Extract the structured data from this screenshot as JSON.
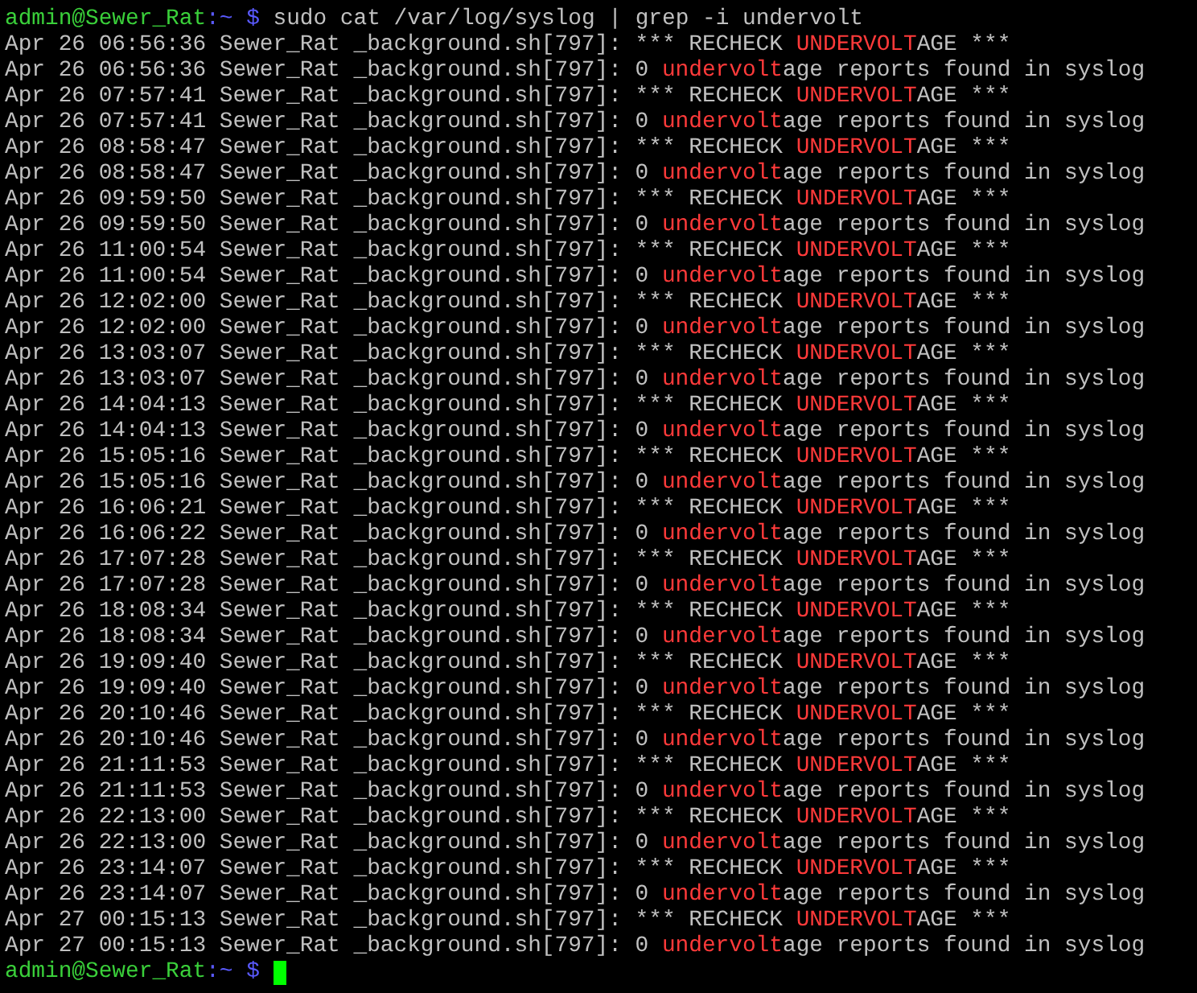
{
  "prompt": {
    "user_host": "admin@Sewer_Rat",
    "path": ":~",
    "symbol": "$",
    "command": "sudo cat /var/log/syslog | grep -i undervolt"
  },
  "lines": [
    {
      "segments": [
        {
          "text": "Apr 26 06:56:36 Sewer_Rat _background.sh[797]: *** RECHECK ",
          "kind": "plain"
        },
        {
          "text": "UNDERVOLT",
          "kind": "match"
        },
        {
          "text": "AGE ***",
          "kind": "plain"
        }
      ]
    },
    {
      "segments": [
        {
          "text": "Apr 26 06:56:36 Sewer_Rat _background.sh[797]: 0 ",
          "kind": "plain"
        },
        {
          "text": "undervolt",
          "kind": "match"
        },
        {
          "text": "age reports found in syslog",
          "kind": "plain"
        }
      ]
    },
    {
      "segments": [
        {
          "text": "Apr 26 07:57:41 Sewer_Rat _background.sh[797]: *** RECHECK ",
          "kind": "plain"
        },
        {
          "text": "UNDERVOLT",
          "kind": "match"
        },
        {
          "text": "AGE ***",
          "kind": "plain"
        }
      ]
    },
    {
      "segments": [
        {
          "text": "Apr 26 07:57:41 Sewer_Rat _background.sh[797]: 0 ",
          "kind": "plain"
        },
        {
          "text": "undervolt",
          "kind": "match"
        },
        {
          "text": "age reports found in syslog",
          "kind": "plain"
        }
      ]
    },
    {
      "segments": [
        {
          "text": "Apr 26 08:58:47 Sewer_Rat _background.sh[797]: *** RECHECK ",
          "kind": "plain"
        },
        {
          "text": "UNDERVOLT",
          "kind": "match"
        },
        {
          "text": "AGE ***",
          "kind": "plain"
        }
      ]
    },
    {
      "segments": [
        {
          "text": "Apr 26 08:58:47 Sewer_Rat _background.sh[797]: 0 ",
          "kind": "plain"
        },
        {
          "text": "undervolt",
          "kind": "match"
        },
        {
          "text": "age reports found in syslog",
          "kind": "plain"
        }
      ]
    },
    {
      "segments": [
        {
          "text": "Apr 26 09:59:50 Sewer_Rat _background.sh[797]: *** RECHECK ",
          "kind": "plain"
        },
        {
          "text": "UNDERVOLT",
          "kind": "match"
        },
        {
          "text": "AGE ***",
          "kind": "plain"
        }
      ]
    },
    {
      "segments": [
        {
          "text": "Apr 26 09:59:50 Sewer_Rat _background.sh[797]: 0 ",
          "kind": "plain"
        },
        {
          "text": "undervolt",
          "kind": "match"
        },
        {
          "text": "age reports found in syslog",
          "kind": "plain"
        }
      ]
    },
    {
      "segments": [
        {
          "text": "Apr 26 11:00:54 Sewer_Rat _background.sh[797]: *** RECHECK ",
          "kind": "plain"
        },
        {
          "text": "UNDERVOLT",
          "kind": "match"
        },
        {
          "text": "AGE ***",
          "kind": "plain"
        }
      ]
    },
    {
      "segments": [
        {
          "text": "Apr 26 11:00:54 Sewer_Rat _background.sh[797]: 0 ",
          "kind": "plain"
        },
        {
          "text": "undervolt",
          "kind": "match"
        },
        {
          "text": "age reports found in syslog",
          "kind": "plain"
        }
      ]
    },
    {
      "segments": [
        {
          "text": "Apr 26 12:02:00 Sewer_Rat _background.sh[797]: *** RECHECK ",
          "kind": "plain"
        },
        {
          "text": "UNDERVOLT",
          "kind": "match"
        },
        {
          "text": "AGE ***",
          "kind": "plain"
        }
      ]
    },
    {
      "segments": [
        {
          "text": "Apr 26 12:02:00 Sewer_Rat _background.sh[797]: 0 ",
          "kind": "plain"
        },
        {
          "text": "undervolt",
          "kind": "match"
        },
        {
          "text": "age reports found in syslog",
          "kind": "plain"
        }
      ]
    },
    {
      "segments": [
        {
          "text": "Apr 26 13:03:07 Sewer_Rat _background.sh[797]: *** RECHECK ",
          "kind": "plain"
        },
        {
          "text": "UNDERVOLT",
          "kind": "match"
        },
        {
          "text": "AGE ***",
          "kind": "plain"
        }
      ]
    },
    {
      "segments": [
        {
          "text": "Apr 26 13:03:07 Sewer_Rat _background.sh[797]: 0 ",
          "kind": "plain"
        },
        {
          "text": "undervolt",
          "kind": "match"
        },
        {
          "text": "age reports found in syslog",
          "kind": "plain"
        }
      ]
    },
    {
      "segments": [
        {
          "text": "Apr 26 14:04:13 Sewer_Rat _background.sh[797]: *** RECHECK ",
          "kind": "plain"
        },
        {
          "text": "UNDERVOLT",
          "kind": "match"
        },
        {
          "text": "AGE ***",
          "kind": "plain"
        }
      ]
    },
    {
      "segments": [
        {
          "text": "Apr 26 14:04:13 Sewer_Rat _background.sh[797]: 0 ",
          "kind": "plain"
        },
        {
          "text": "undervolt",
          "kind": "match"
        },
        {
          "text": "age reports found in syslog",
          "kind": "plain"
        }
      ]
    },
    {
      "segments": [
        {
          "text": "Apr 26 15:05:16 Sewer_Rat _background.sh[797]: *** RECHECK ",
          "kind": "plain"
        },
        {
          "text": "UNDERVOLT",
          "kind": "match"
        },
        {
          "text": "AGE ***",
          "kind": "plain"
        }
      ]
    },
    {
      "segments": [
        {
          "text": "Apr 26 15:05:16 Sewer_Rat _background.sh[797]: 0 ",
          "kind": "plain"
        },
        {
          "text": "undervolt",
          "kind": "match"
        },
        {
          "text": "age reports found in syslog",
          "kind": "plain"
        }
      ]
    },
    {
      "segments": [
        {
          "text": "Apr 26 16:06:21 Sewer_Rat _background.sh[797]: *** RECHECK ",
          "kind": "plain"
        },
        {
          "text": "UNDERVOLT",
          "kind": "match"
        },
        {
          "text": "AGE ***",
          "kind": "plain"
        }
      ]
    },
    {
      "segments": [
        {
          "text": "Apr 26 16:06:22 Sewer_Rat _background.sh[797]: 0 ",
          "kind": "plain"
        },
        {
          "text": "undervolt",
          "kind": "match"
        },
        {
          "text": "age reports found in syslog",
          "kind": "plain"
        }
      ]
    },
    {
      "segments": [
        {
          "text": "Apr 26 17:07:28 Sewer_Rat _background.sh[797]: *** RECHECK ",
          "kind": "plain"
        },
        {
          "text": "UNDERVOLT",
          "kind": "match"
        },
        {
          "text": "AGE ***",
          "kind": "plain"
        }
      ]
    },
    {
      "segments": [
        {
          "text": "Apr 26 17:07:28 Sewer_Rat _background.sh[797]: 0 ",
          "kind": "plain"
        },
        {
          "text": "undervolt",
          "kind": "match"
        },
        {
          "text": "age reports found in syslog",
          "kind": "plain"
        }
      ]
    },
    {
      "segments": [
        {
          "text": "Apr 26 18:08:34 Sewer_Rat _background.sh[797]: *** RECHECK ",
          "kind": "plain"
        },
        {
          "text": "UNDERVOLT",
          "kind": "match"
        },
        {
          "text": "AGE ***",
          "kind": "plain"
        }
      ]
    },
    {
      "segments": [
        {
          "text": "Apr 26 18:08:34 Sewer_Rat _background.sh[797]: 0 ",
          "kind": "plain"
        },
        {
          "text": "undervolt",
          "kind": "match"
        },
        {
          "text": "age reports found in syslog",
          "kind": "plain"
        }
      ]
    },
    {
      "segments": [
        {
          "text": "Apr 26 19:09:40 Sewer_Rat _background.sh[797]: *** RECHECK ",
          "kind": "plain"
        },
        {
          "text": "UNDERVOLT",
          "kind": "match"
        },
        {
          "text": "AGE ***",
          "kind": "plain"
        }
      ]
    },
    {
      "segments": [
        {
          "text": "Apr 26 19:09:40 Sewer_Rat _background.sh[797]: 0 ",
          "kind": "plain"
        },
        {
          "text": "undervolt",
          "kind": "match"
        },
        {
          "text": "age reports found in syslog",
          "kind": "plain"
        }
      ]
    },
    {
      "segments": [
        {
          "text": "Apr 26 20:10:46 Sewer_Rat _background.sh[797]: *** RECHECK ",
          "kind": "plain"
        },
        {
          "text": "UNDERVOLT",
          "kind": "match"
        },
        {
          "text": "AGE ***",
          "kind": "plain"
        }
      ]
    },
    {
      "segments": [
        {
          "text": "Apr 26 20:10:46 Sewer_Rat _background.sh[797]: 0 ",
          "kind": "plain"
        },
        {
          "text": "undervolt",
          "kind": "match"
        },
        {
          "text": "age reports found in syslog",
          "kind": "plain"
        }
      ]
    },
    {
      "segments": [
        {
          "text": "Apr 26 21:11:53 Sewer_Rat _background.sh[797]: *** RECHECK ",
          "kind": "plain"
        },
        {
          "text": "UNDERVOLT",
          "kind": "match"
        },
        {
          "text": "AGE ***",
          "kind": "plain"
        }
      ]
    },
    {
      "segments": [
        {
          "text": "Apr 26 21:11:53 Sewer_Rat _background.sh[797]: 0 ",
          "kind": "plain"
        },
        {
          "text": "undervolt",
          "kind": "match"
        },
        {
          "text": "age reports found in syslog",
          "kind": "plain"
        }
      ]
    },
    {
      "segments": [
        {
          "text": "Apr 26 22:13:00 Sewer_Rat _background.sh[797]: *** RECHECK ",
          "kind": "plain"
        },
        {
          "text": "UNDERVOLT",
          "kind": "match"
        },
        {
          "text": "AGE ***",
          "kind": "plain"
        }
      ]
    },
    {
      "segments": [
        {
          "text": "Apr 26 22:13:00 Sewer_Rat _background.sh[797]: 0 ",
          "kind": "plain"
        },
        {
          "text": "undervolt",
          "kind": "match"
        },
        {
          "text": "age reports found in syslog",
          "kind": "plain"
        }
      ]
    },
    {
      "segments": [
        {
          "text": "Apr 26 23:14:07 Sewer_Rat _background.sh[797]: *** RECHECK ",
          "kind": "plain"
        },
        {
          "text": "UNDERVOLT",
          "kind": "match"
        },
        {
          "text": "AGE ***",
          "kind": "plain"
        }
      ]
    },
    {
      "segments": [
        {
          "text": "Apr 26 23:14:07 Sewer_Rat _background.sh[797]: 0 ",
          "kind": "plain"
        },
        {
          "text": "undervolt",
          "kind": "match"
        },
        {
          "text": "age reports found in syslog",
          "kind": "plain"
        }
      ]
    },
    {
      "segments": [
        {
          "text": "Apr 27 00:15:13 Sewer_Rat _background.sh[797]: *** RECHECK ",
          "kind": "plain"
        },
        {
          "text": "UNDERVOLT",
          "kind": "match"
        },
        {
          "text": "AGE ***",
          "kind": "plain"
        }
      ]
    },
    {
      "segments": [
        {
          "text": "Apr 27 00:15:13 Sewer_Rat _background.sh[797]: 0 ",
          "kind": "plain"
        },
        {
          "text": "undervolt",
          "kind": "match"
        },
        {
          "text": "age reports found in syslog",
          "kind": "plain"
        }
      ]
    }
  ],
  "final_prompt": {
    "user_host": "admin@Sewer_Rat",
    "path": ":~",
    "symbol": "$"
  }
}
